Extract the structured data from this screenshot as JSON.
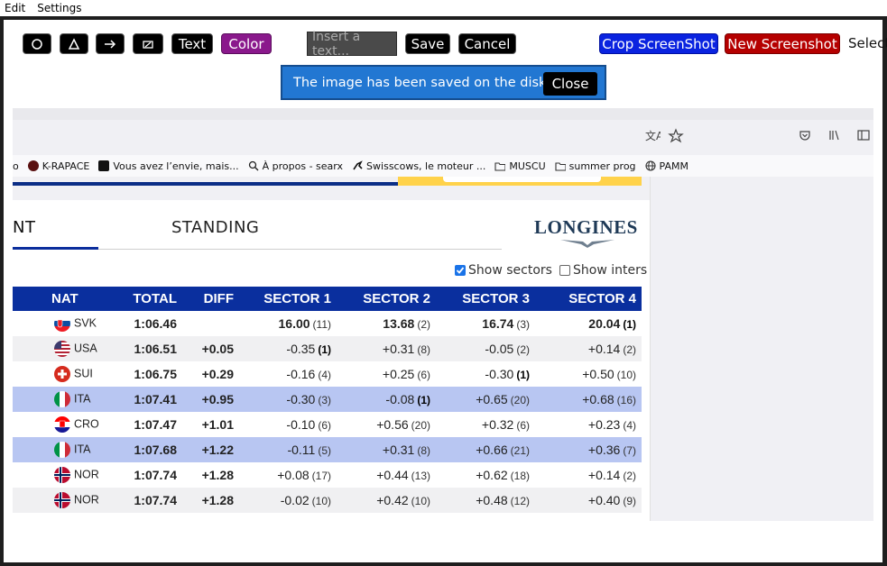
{
  "menu": {
    "edit": "Edit",
    "settings": "Settings"
  },
  "toolbar": {
    "circle_icon": "circle-icon",
    "triangle_icon": "triangle-icon",
    "arrow_icon": "arrow-icon",
    "eraser_icon": "eraser-icon",
    "text_label": "Text",
    "color_label": "Color",
    "input_placeholder": "Insert a text...",
    "save_label": "Save",
    "cancel_label": "Cancel",
    "crop_label": "Crop ScreenShot",
    "new_label": "New Screenshot",
    "select_label": "Select"
  },
  "toast": {
    "message": "The image has been saved on the disk!",
    "close_label": "Close"
  },
  "browser": {
    "bookmarks": [
      {
        "label": "o",
        "icon": ""
      },
      {
        "label": "K-RAPACE",
        "icon": "circle-logo-icon"
      },
      {
        "label": "Vous avez l’envie, mais...",
        "icon": "video-icon"
      },
      {
        "label": "À propos - searx",
        "icon": "search-icon"
      },
      {
        "label": "Swisscows, le moteur ...",
        "icon": "cow-icon"
      },
      {
        "label": "MUSCU",
        "icon": "folder-icon"
      },
      {
        "label": "summer prog",
        "icon": "folder-icon"
      },
      {
        "label": "PAMM",
        "icon": "globe-icon"
      }
    ]
  },
  "panel": {
    "tab_active": "NT",
    "tab_standing": "STANDING",
    "logo": "LONGINES",
    "show_sectors": "Show sectors",
    "show_inters": "Show inters",
    "columns": [
      "NAT",
      "TOTAL",
      "DIFF",
      "SECTOR 1",
      "SECTOR 2",
      "SECTOR 3",
      "SECTOR 4"
    ],
    "rows": [
      {
        "nat": "SVK",
        "total": "1:06.46",
        "diff": "",
        "s1": "16.00",
        "r1": "(11)",
        "s2": "13.68",
        "r2": "(2)",
        "s3": "16.74",
        "r3": "(3)",
        "s4": "20.04",
        "r4": "(1)"
      },
      {
        "nat": "USA",
        "total": "1:06.51",
        "diff": "+0.05",
        "s1": "-0.35",
        "r1": "(1)",
        "s2": "+0.31",
        "r2": "(8)",
        "s3": "-0.05",
        "r3": "(2)",
        "s4": "+0.14",
        "r4": "(2)"
      },
      {
        "nat": "SUI",
        "total": "1:06.75",
        "diff": "+0.29",
        "s1": "-0.16",
        "r1": "(4)",
        "s2": "+0.25",
        "r2": "(6)",
        "s3": "-0.30",
        "r3": "(1)",
        "s4": "+0.50",
        "r4": "(10)"
      },
      {
        "nat": "ITA",
        "total": "1:07.41",
        "diff": "+0.95",
        "s1": "-0.30",
        "r1": "(3)",
        "s2": "-0.08",
        "r2": "(1)",
        "s3": "+0.65",
        "r3": "(20)",
        "s4": "+0.68",
        "r4": "(16)"
      },
      {
        "nat": "CRO",
        "total": "1:07.47",
        "diff": "+1.01",
        "s1": "-0.10",
        "r1": "(6)",
        "s2": "+0.56",
        "r2": "(20)",
        "s3": "+0.32",
        "r3": "(6)",
        "s4": "+0.23",
        "r4": "(4)"
      },
      {
        "nat": "ITA",
        "total": "1:07.68",
        "diff": "+1.22",
        "s1": "-0.11",
        "r1": "(5)",
        "s2": "+0.31",
        "r2": "(8)",
        "s3": "+0.66",
        "r3": "(21)",
        "s4": "+0.36",
        "r4": "(7)"
      },
      {
        "nat": "NOR",
        "total": "1:07.74",
        "diff": "+1.28",
        "s1": "+0.08",
        "r1": "(17)",
        "s2": "+0.44",
        "r2": "(13)",
        "s3": "+0.62",
        "r3": "(18)",
        "s4": "+0.14",
        "r4": "(2)"
      },
      {
        "nat": "NOR",
        "total": "1:07.74",
        "diff": "+1.28",
        "s1": "-0.02",
        "r1": "(10)",
        "s2": "+0.42",
        "r2": "(10)",
        "s3": "+0.48",
        "r3": "(12)",
        "s4": "+0.40",
        "r4": "(9)"
      }
    ]
  },
  "colors": {
    "accent_blue": "#0a2f9e",
    "toast_bg": "#2277d2",
    "crop_button": "#0a23e0",
    "new_button": "#b50000",
    "color_button": "#8a198c",
    "row_highlight": "#b8c6f2"
  }
}
